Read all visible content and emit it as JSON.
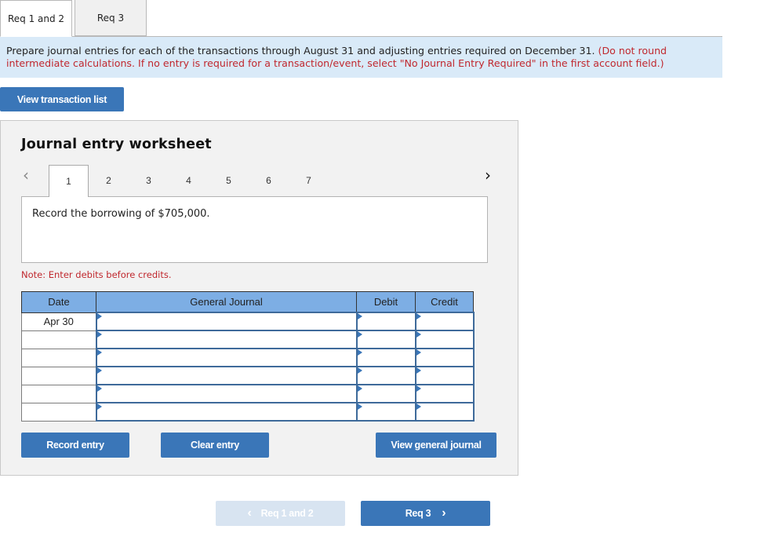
{
  "tabs": [
    {
      "label": "Req 1 and 2",
      "active": true
    },
    {
      "label": "Req 3",
      "active": false
    }
  ],
  "instructions": {
    "main": "Prepare journal entries for each of the transactions through August 31 and adjusting entries required on December 31.",
    "note": "(Do not round intermediate calculations. If no entry is required for a transaction/event, select \"No Journal Entry Required\" in the first account field.)"
  },
  "view_transaction_list_label": "View transaction list",
  "worksheet": {
    "title": "Journal entry worksheet",
    "prev_icon": "‹",
    "next_icon": "›",
    "pages": [
      "1",
      "2",
      "3",
      "4",
      "5",
      "6",
      "7"
    ],
    "active_page": "1",
    "description": "Record the borrowing of $705,000.",
    "note": "Note: Enter debits before credits.",
    "table": {
      "headers": {
        "date": "Date",
        "journal": "General Journal",
        "debit": "Debit",
        "credit": "Credit"
      },
      "rows": [
        {
          "date": "Apr 30",
          "account": "",
          "debit": "",
          "credit": ""
        },
        {
          "date": "",
          "account": "",
          "debit": "",
          "credit": ""
        },
        {
          "date": "",
          "account": "",
          "debit": "",
          "credit": ""
        },
        {
          "date": "",
          "account": "",
          "debit": "",
          "credit": ""
        },
        {
          "date": "",
          "account": "",
          "debit": "",
          "credit": ""
        },
        {
          "date": "",
          "account": "",
          "debit": "",
          "credit": ""
        }
      ]
    },
    "buttons": {
      "record": "Record entry",
      "clear": "Clear entry",
      "view_journal": "View general journal"
    }
  },
  "bottom_nav": {
    "prev_label": "Req 1 and 2",
    "prev_icon": "‹",
    "next_label": "Req 3",
    "next_icon": "›"
  },
  "colors": {
    "accent": "#3a76b8",
    "header_blue": "#7daee4",
    "instruction_bg": "#d9eaf8",
    "warning_red": "#c0282e"
  }
}
